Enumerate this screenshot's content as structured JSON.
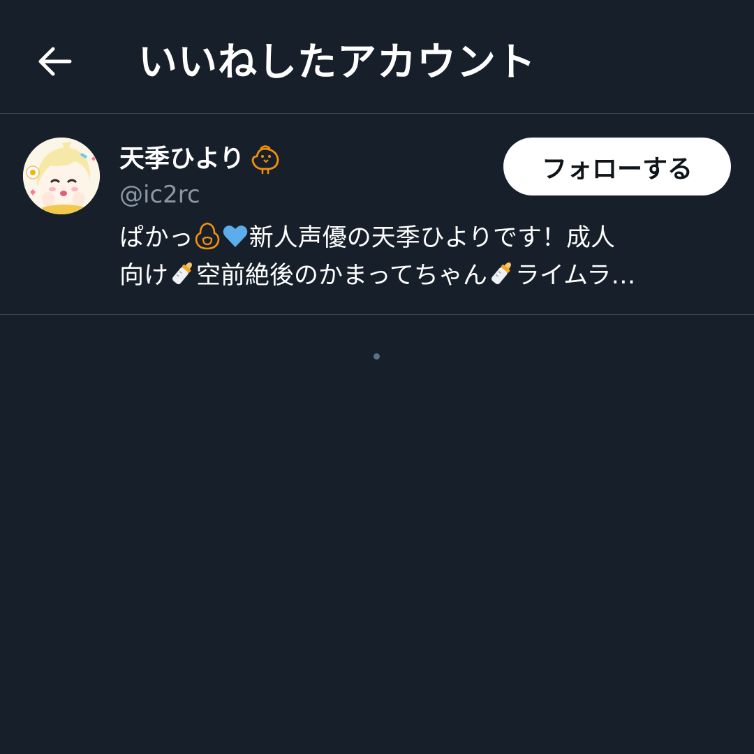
{
  "header": {
    "title": "いいねしたアカウント",
    "back_icon": "arrow-left-icon"
  },
  "user": {
    "display_name": "天季ひより",
    "name_badge_icon": "chick-outline-icon",
    "handle": "@ic2rc",
    "follow_label": "フォローする",
    "bio": {
      "line1_a": "ぱかっ",
      "line1_b": "新人声優の天季ひよりです！成人",
      "line2_a": "向け",
      "line2_b": "空前絶後のかまってちゃん",
      "line2_c": "ライムラ…"
    }
  },
  "colors": {
    "background": "#17202a",
    "divider": "#38444d",
    "secondary_text": "#8b98a5",
    "accent_orange": "#f4900c",
    "blue_heart": "#5dadec"
  }
}
